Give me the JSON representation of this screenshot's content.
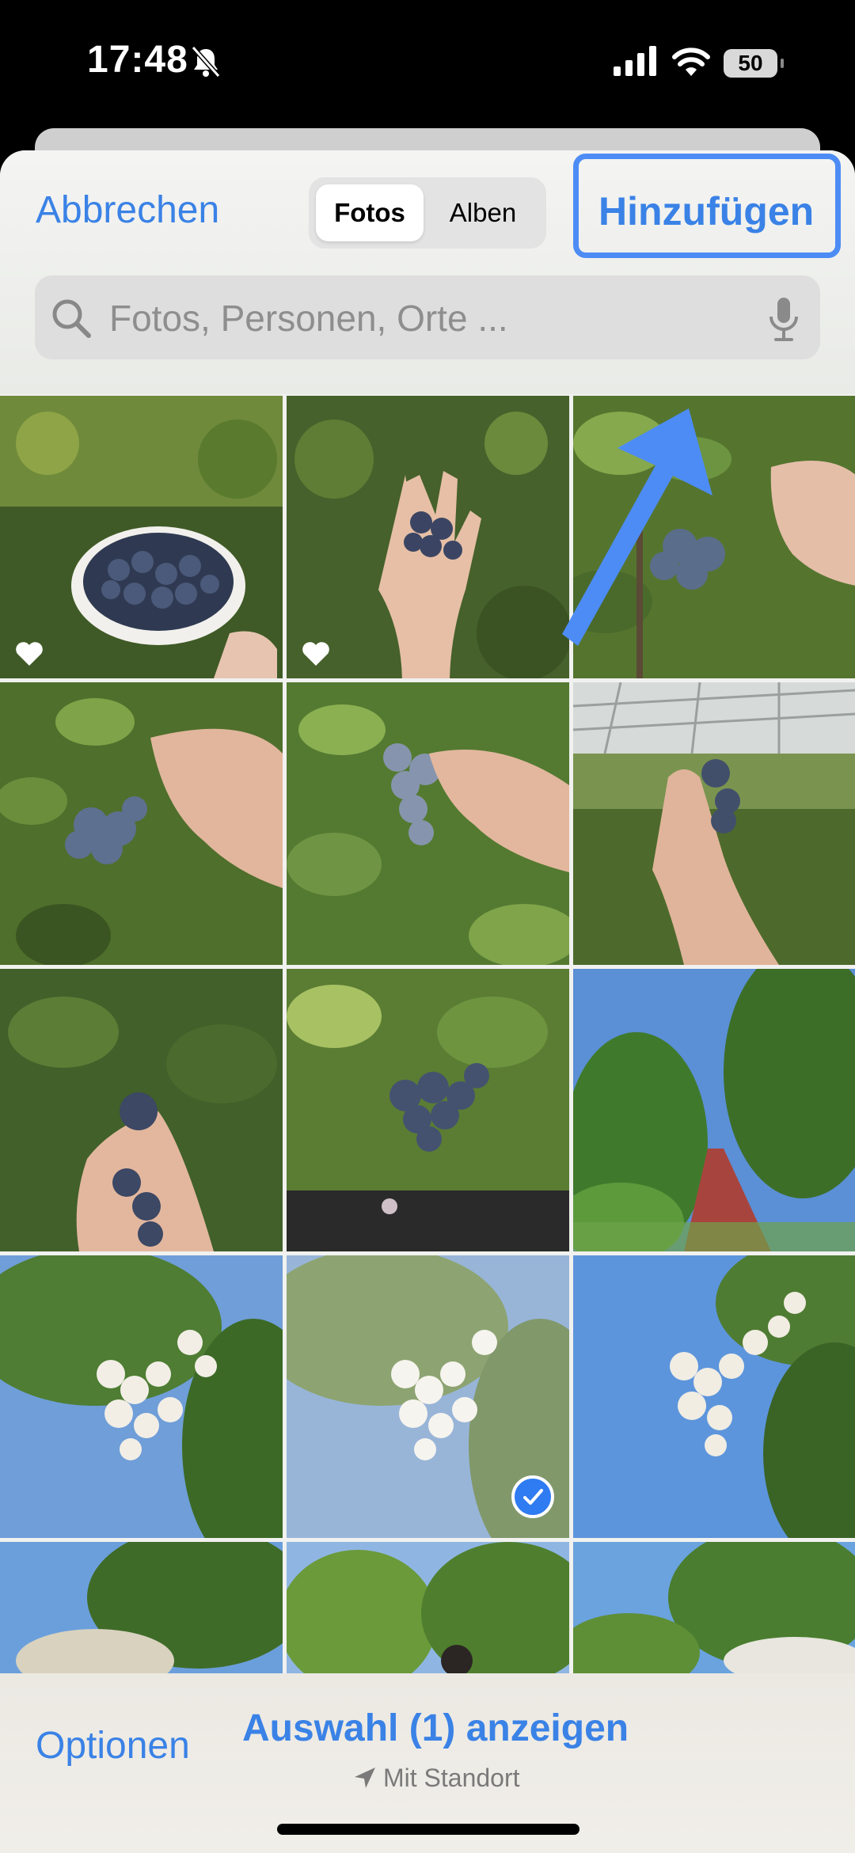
{
  "status": {
    "time": "17:48",
    "battery": "50"
  },
  "header": {
    "cancel_label": "Abbrechen",
    "segments": [
      "Fotos",
      "Alben"
    ],
    "add_label": "Hinzufügen",
    "search_placeholder": "Fotos, Personen, Orte ..."
  },
  "grid": {
    "photos": [
      {
        "subject": "blueberry-bowl",
        "favorite": true
      },
      {
        "subject": "blueberries-in-palm",
        "favorite": true
      },
      {
        "subject": "blueberry-cluster-on-bush"
      },
      {
        "subject": "blueberry-cluster-held"
      },
      {
        "subject": "blueberries-held-closeup"
      },
      {
        "subject": "blueberries-greenhouse"
      },
      {
        "subject": "blueberries-fingers"
      },
      {
        "subject": "blueberry-bush-cluster"
      },
      {
        "subject": "park-path-trees"
      },
      {
        "subject": "white-blossoms"
      },
      {
        "subject": "white-blossoms-selected",
        "selected": true
      },
      {
        "subject": "white-blossoms-sky"
      },
      {
        "subject": "tree-sky"
      },
      {
        "subject": "park-trees-person"
      },
      {
        "subject": "trees-blossoms"
      }
    ]
  },
  "footer": {
    "options_label": "Optionen",
    "show_selection_label": "Auswahl (1) anzeigen",
    "location_label": "Mit Standort"
  },
  "colors": {
    "accent": "#3a82e6",
    "highlight": "#4d8cf5",
    "check": "#2f7bf2"
  }
}
